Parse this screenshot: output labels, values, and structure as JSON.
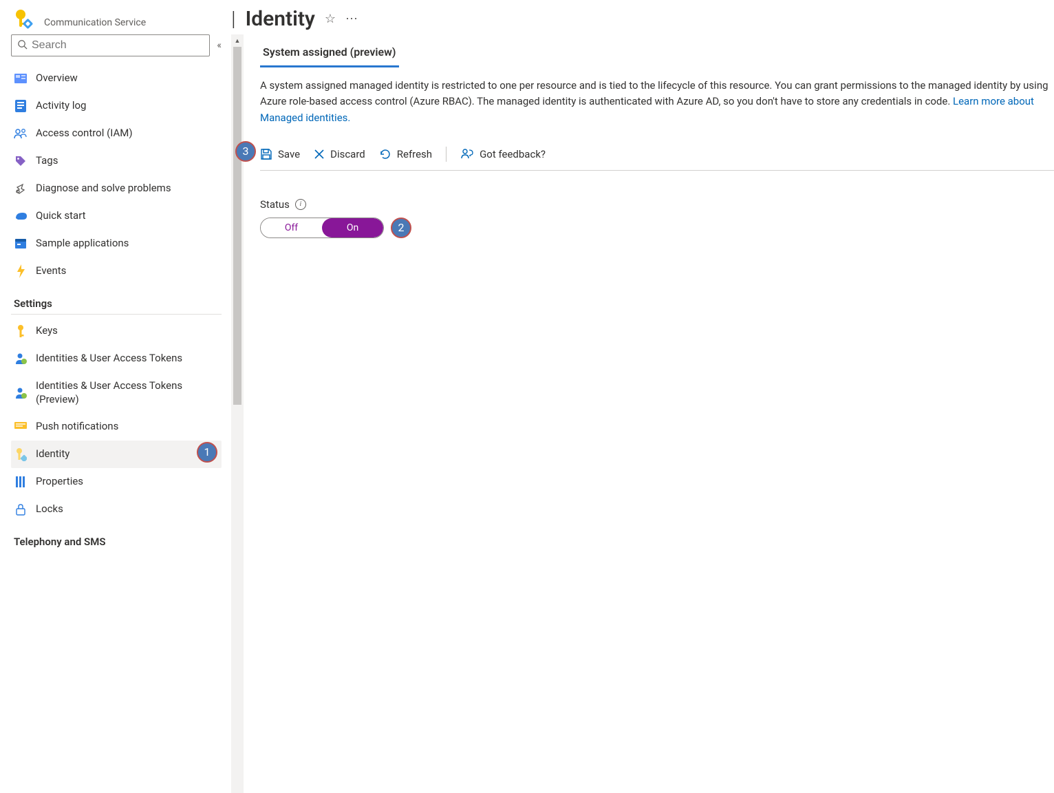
{
  "header": {
    "subtitle": "Communication Service",
    "separator": "|",
    "title": "Identity"
  },
  "sidebar": {
    "search_placeholder": "Search",
    "groups": [
      {
        "section": null,
        "items": [
          {
            "id": "overview",
            "label": "Overview"
          },
          {
            "id": "activity-log",
            "label": "Activity log"
          },
          {
            "id": "access-control",
            "label": "Access control (IAM)"
          },
          {
            "id": "tags",
            "label": "Tags"
          },
          {
            "id": "diagnose",
            "label": "Diagnose and solve problems"
          },
          {
            "id": "quick-start",
            "label": "Quick start"
          },
          {
            "id": "sample-apps",
            "label": "Sample applications"
          },
          {
            "id": "events",
            "label": "Events"
          }
        ]
      },
      {
        "section": "Settings",
        "items": [
          {
            "id": "keys",
            "label": "Keys"
          },
          {
            "id": "identities-tokens",
            "label": "Identities & User Access Tokens"
          },
          {
            "id": "identities-tokens-preview",
            "label": "Identities & User Access Tokens (Preview)"
          },
          {
            "id": "push-notifications",
            "label": "Push notifications"
          },
          {
            "id": "identity",
            "label": "Identity",
            "selected": true
          },
          {
            "id": "properties",
            "label": "Properties"
          },
          {
            "id": "locks",
            "label": "Locks"
          }
        ]
      },
      {
        "section": "Telephony and SMS",
        "items": []
      }
    ]
  },
  "content": {
    "tab": "System assigned (preview)",
    "description_text": "A system assigned managed identity is restricted to one per resource and is tied to the lifecycle of this resource. You can grant permissions to the managed identity by using Azure role-based access control (Azure RBAC). The managed identity is authenticated with Azure AD, so you don't have to store any credentials in code. ",
    "description_link": "Learn more about Managed identities.",
    "toolbar": {
      "save": "Save",
      "discard": "Discard",
      "refresh": "Refresh",
      "feedback": "Got feedback?"
    },
    "status_label": "Status",
    "toggle": {
      "off": "Off",
      "on": "On",
      "value": "On"
    }
  },
  "callouts": {
    "one": "1",
    "two": "2",
    "three": "3"
  }
}
